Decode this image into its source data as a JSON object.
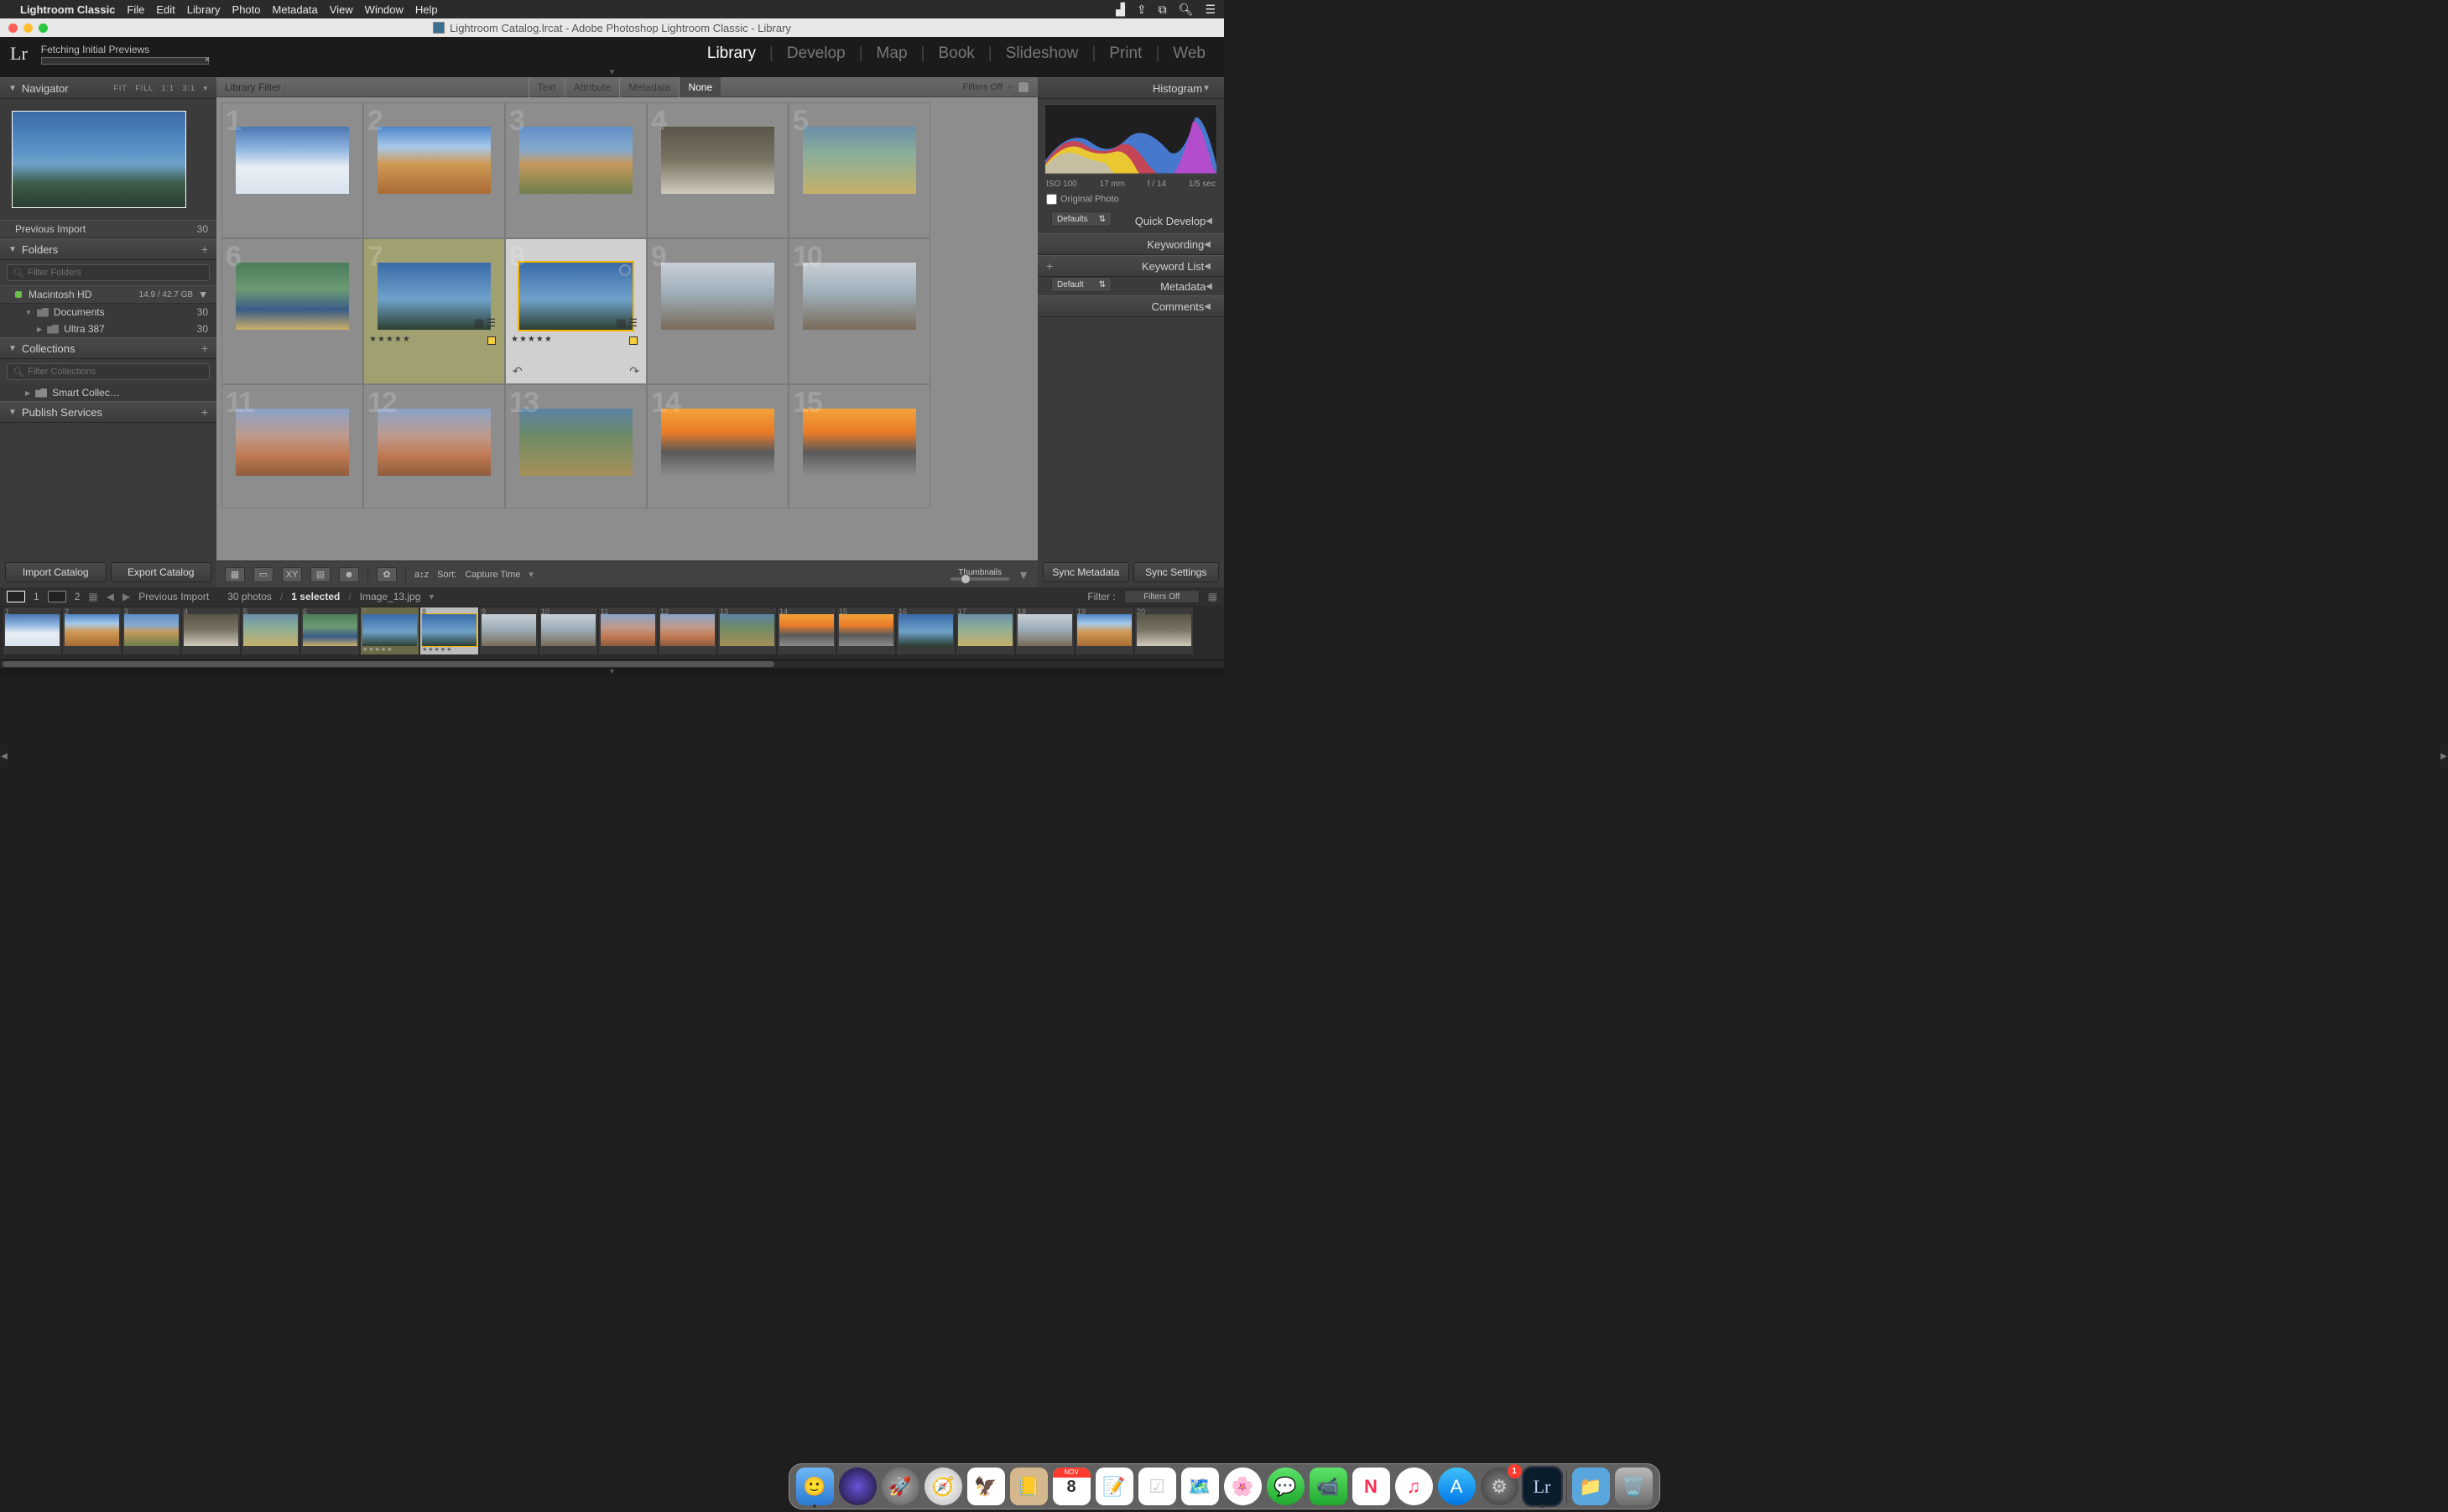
{
  "menubar": {
    "app": "Lightroom Classic",
    "menus": [
      "File",
      "Edit",
      "Library",
      "Photo",
      "Metadata",
      "View",
      "Window",
      "Help"
    ]
  },
  "window_title": "Lightroom Catalog.lrcat - Adobe Photoshop Lightroom Classic - Library",
  "status_text": "Fetching Initial Previews",
  "modules": [
    "Library",
    "Develop",
    "Map",
    "Book",
    "Slideshow",
    "Print",
    "Web"
  ],
  "active_module": "Library",
  "navigator": {
    "title": "Navigator",
    "modes": [
      "FIT",
      "FILL",
      "1:1",
      "3:1"
    ]
  },
  "prev_import": {
    "label": "Previous Import",
    "count": "30"
  },
  "folders": {
    "title": "Folders",
    "filter_placeholder": "Filter Folders",
    "volume": "Macintosh HD",
    "volume_space": "14.9 / 42.7 GB",
    "items": [
      {
        "name": "Documents",
        "count": "30"
      },
      {
        "name": "Ultra 387",
        "count": "30"
      }
    ]
  },
  "collections": {
    "title": "Collections",
    "filter_placeholder": "Filter Collections",
    "item": "Smart Collec…"
  },
  "publish": {
    "title": "Publish Services"
  },
  "import_btn": "Import Catalog",
  "export_btn": "Export Catalog",
  "library_filter": {
    "label": "Library Filter :",
    "tabs": [
      "Text",
      "Attribute",
      "Metadata",
      "None"
    ],
    "active": "None",
    "filters_off": "Filters Off"
  },
  "grid_numbers": [
    "1",
    "2",
    "3",
    "4",
    "5",
    "6",
    "7",
    "8",
    "9",
    "10",
    "11",
    "12",
    "13",
    "14",
    "15"
  ],
  "stars": "★★★★★",
  "sort": {
    "label": "Sort:",
    "value": "Capture Time"
  },
  "thumbnails_label": "Thumbnails",
  "right": {
    "histogram": "Histogram",
    "exif": {
      "iso": "ISO 100",
      "focal": "17 mm",
      "aperture": "f / 14",
      "shutter": "1/5 sec"
    },
    "original_photo": "Original Photo",
    "defaults": "Defaults",
    "default": "Default",
    "panels": [
      "Quick Develop",
      "Keywording",
      "Keyword List",
      "Metadata",
      "Comments"
    ],
    "sync_meta": "Sync Metadata",
    "sync_set": "Sync Settings"
  },
  "filmstrip": {
    "screen1": "1",
    "screen2": "2",
    "source": "Previous Import",
    "count": "30 photos",
    "selected": "1 selected",
    "filename": "Image_13.jpg",
    "filter_label": "Filter :",
    "filter_value": "Filters Off"
  },
  "dock_icons": [
    "finder",
    "siri",
    "launchpad",
    "safari",
    "mail",
    "contacts",
    "calendar",
    "notes",
    "reminders",
    "maps",
    "photos",
    "messages",
    "facetime",
    "news",
    "music",
    "appstore",
    "settings",
    "lightroom"
  ],
  "dock_calendar": {
    "month": "NOV",
    "day": "8"
  },
  "dock_badge": "1"
}
